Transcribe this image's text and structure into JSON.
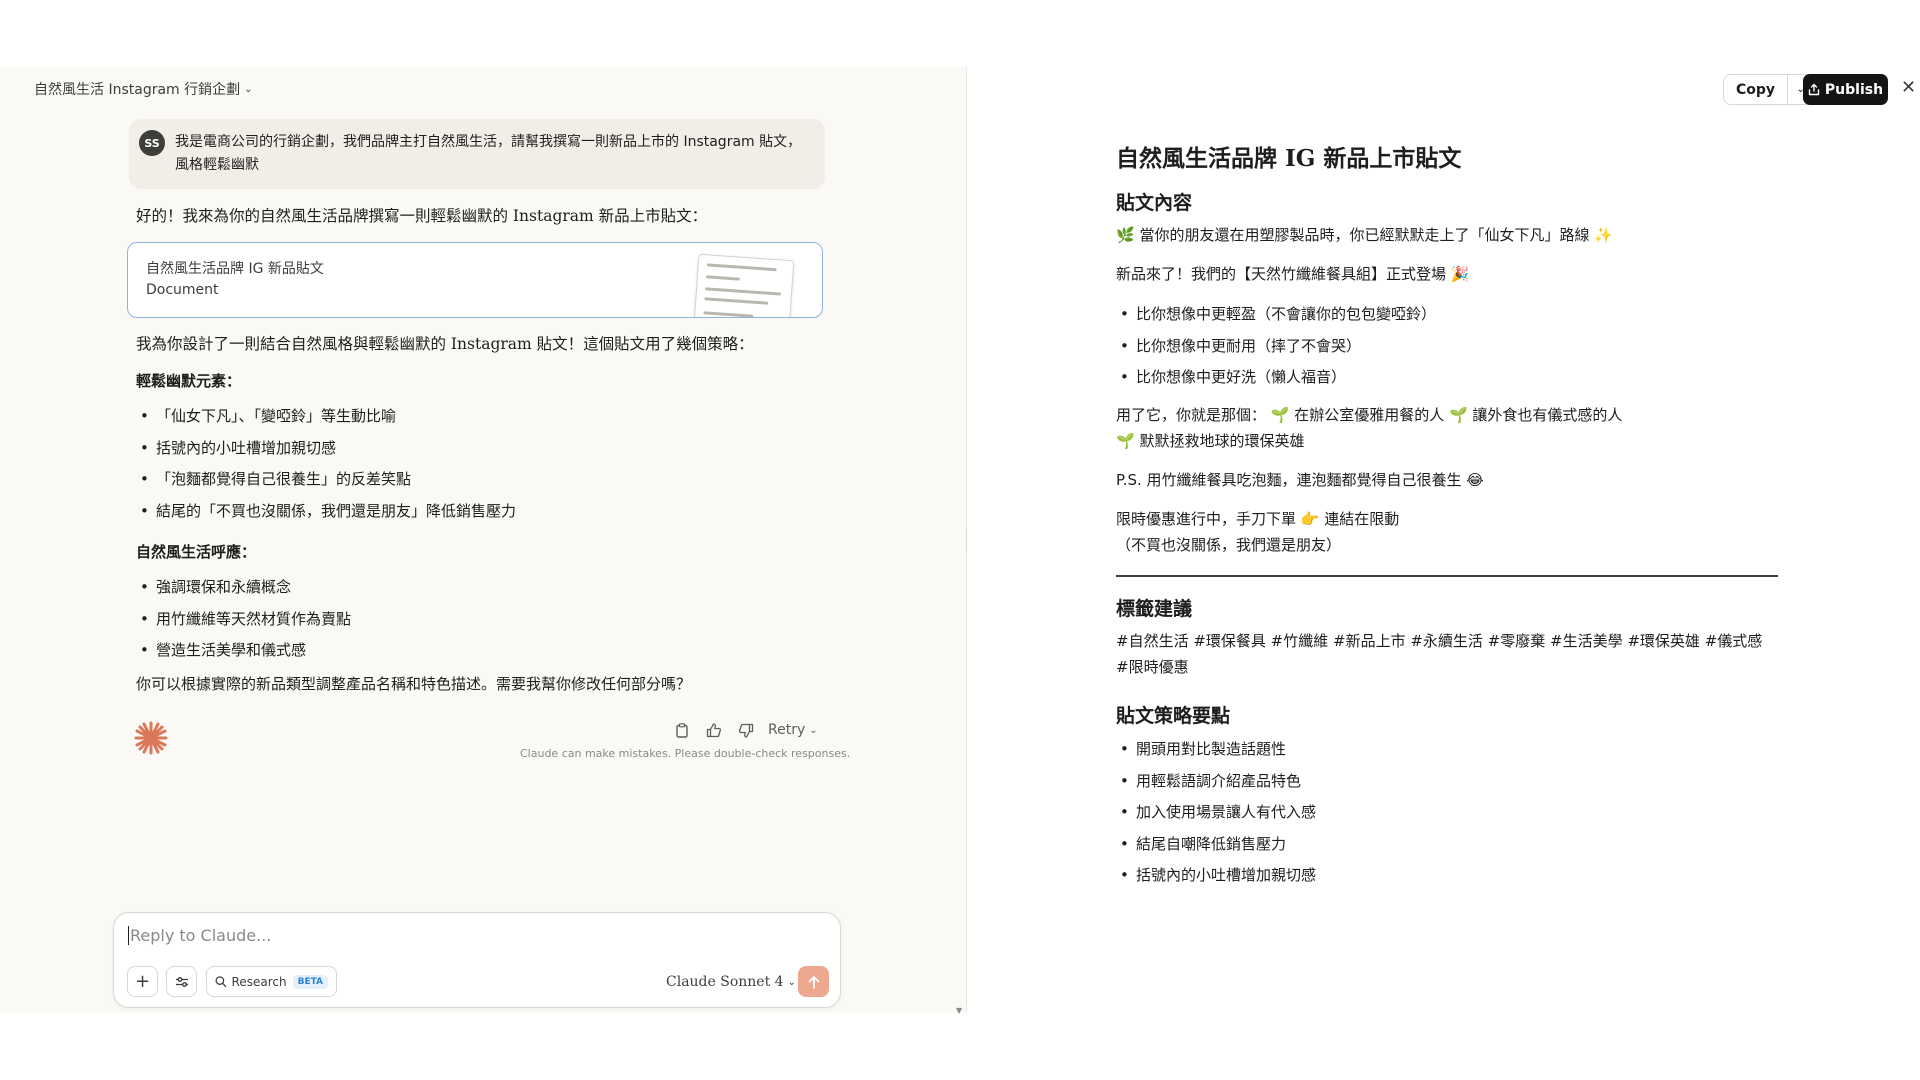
{
  "conversation": {
    "title": "自然風生活 Instagram 行銷企劃",
    "user_avatar": "SS",
    "user_message": "我是電商公司的行銷企劃，我們品牌主打自然風生活，請幫我撰寫一則新品上市的 Instagram 貼文，風格輕鬆幽默",
    "assistant_intro": "好的！我來為你的自然風生活品牌撰寫一則輕鬆幽默的 Instagram 新品上市貼文：",
    "artifact": {
      "title": "自然風生活品牌 IG 新品貼文",
      "subtitle": "Document"
    },
    "summary": "我為你設計了一則結合自然風格與輕鬆幽默的 Instagram 貼文！這個貼文用了幾個策略：",
    "section1_title": "輕鬆幽默元素：",
    "section1_items": [
      "「仙女下凡」、「變啞鈴」等生動比喻",
      "括號內的小吐槽增加親切感",
      "「泡麵都覺得自己很養生」的反差笑點",
      "結尾的「不買也沒關係，我們還是朋友」降低銷售壓力"
    ],
    "section2_title": "自然風生活呼應：",
    "section2_items": [
      "強調環保和永續概念",
      "用竹纖維等天然材質作為賣點",
      "營造生活美學和儀式感"
    ],
    "closing": "你可以根據實際的新品類型調整產品名稱和特色描述。需要我幫你修改任何部分嗎？",
    "retry_label": "Retry",
    "disclaimer": "Claude can make mistakes. Please double-check responses."
  },
  "composer": {
    "placeholder": "Reply to Claude...",
    "research_label": "Research",
    "beta_label": "BETA",
    "model_label": "Claude Sonnet 4"
  },
  "artifact_panel": {
    "copy_label": "Copy",
    "publish_label": "Publish",
    "title": "自然風生活品牌 IG 新品上市貼文",
    "post_heading": "貼文內容",
    "line1": "🌿 當你的朋友還在用塑膠製品時，你已經默默走上了「仙女下凡」路線 ✨",
    "line2": "新品來了！我們的【天然竹纖維餐具組】正式登場 🎉",
    "features": [
      "比你想像中更輕盈（不會讓你的包包變啞鈴）",
      "比你想像中更耐用（摔了不會哭）",
      "比你想像中更好洗（懶人福音）"
    ],
    "line3a": "用了它，你就是那個： 🌱 在辦公室優雅用餐的人 🌱 讓外食也有儀式感的人",
    "line3b": "🌱 默默拯救地球的環保英雄",
    "line4": "P.S. 用竹纖維餐具吃泡麵，連泡麵都覺得自己很養生 😂",
    "line5a": "限時優惠進行中，手刀下單 👉 連結在限動",
    "line5b": "（不買也沒關係，我們還是朋友）",
    "tags_heading": "標籤建議",
    "tags": "#自然生活 #環保餐具 #竹纖維 #新品上市 #永續生活 #零廢棄 #生活美學 #環保英雄 #儀式感 #限時優惠",
    "strategy_heading": "貼文策略要點",
    "strategy_items": [
      "開頭用對比製造話題性",
      "用輕鬆語調介紹產品特色",
      "加入使用場景讓人有代入感",
      "結尾自嘲降低銷售壓力",
      "括號內的小吐槽增加親切感"
    ]
  },
  "colors": {
    "accent": "#d97757",
    "send": "#eda890",
    "beta": "#2c84db"
  }
}
